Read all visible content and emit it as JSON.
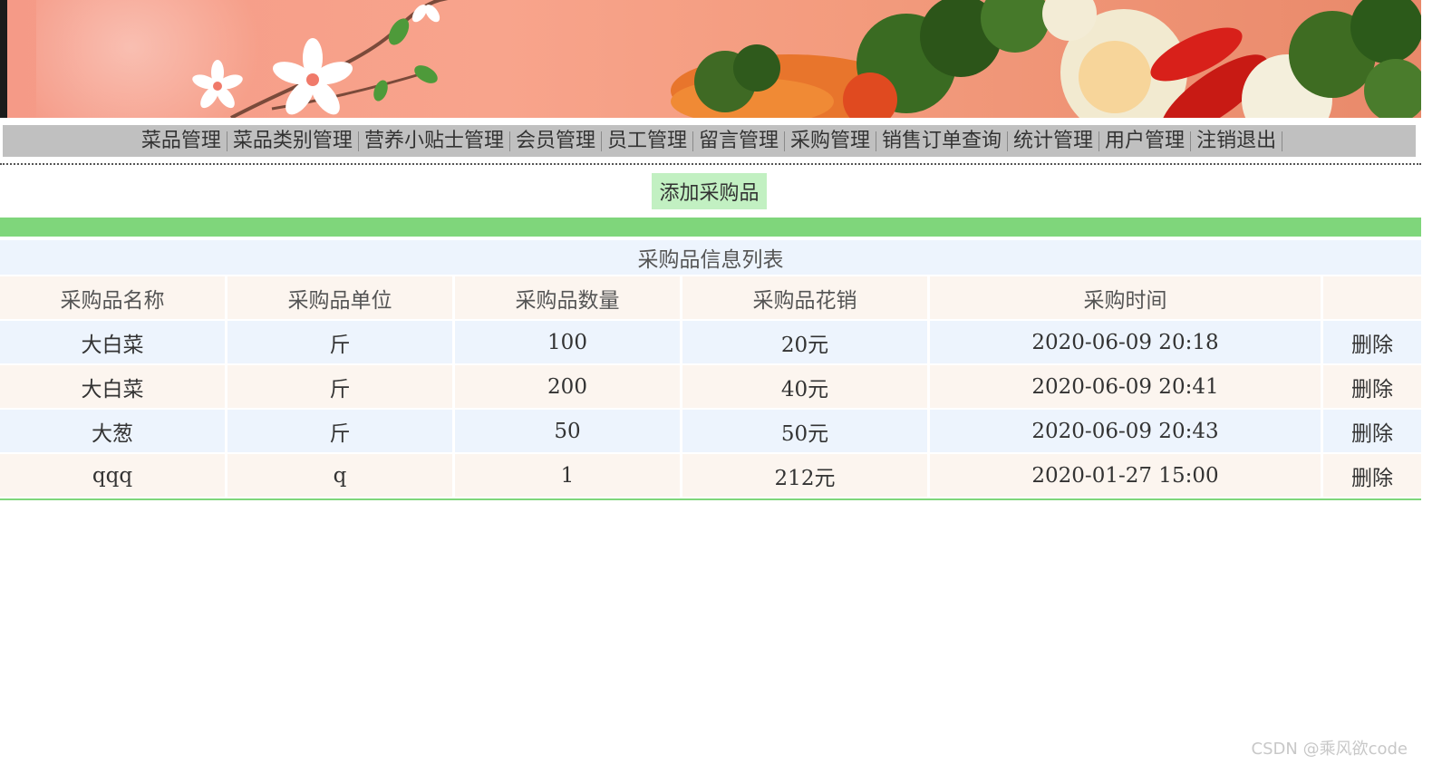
{
  "nav": {
    "items": [
      {
        "label": "菜品管理"
      },
      {
        "label": "菜品类别管理"
      },
      {
        "label": "营养小贴士管理"
      },
      {
        "label": "会员管理"
      },
      {
        "label": "员工管理"
      },
      {
        "label": "留言管理"
      },
      {
        "label": "采购管理"
      },
      {
        "label": "销售订单查询"
      },
      {
        "label": "统计管理"
      },
      {
        "label": "用户管理"
      },
      {
        "label": "注销退出"
      }
    ]
  },
  "actions": {
    "add_label": "添加采购品"
  },
  "table": {
    "caption": "采购品信息列表",
    "headers": [
      "采购品名称",
      "采购品单位",
      "采购品数量",
      "采购品花销",
      "采购时间",
      ""
    ],
    "rows": [
      {
        "name": "大白菜",
        "unit": "斤",
        "quantity": "100",
        "cost": "20元",
        "time": "2020-06-09 20:18",
        "action": "删除"
      },
      {
        "name": "大白菜",
        "unit": "斤",
        "quantity": "200",
        "cost": "40元",
        "time": "2020-06-09 20:41",
        "action": "删除"
      },
      {
        "name": "大葱",
        "unit": "斤",
        "quantity": "50",
        "cost": "50元",
        "time": "2020-06-09 20:43",
        "action": "删除"
      },
      {
        "name": "qqq",
        "unit": "q",
        "quantity": "1",
        "cost": "212元",
        "time": "2020-01-27 15:00",
        "action": "删除"
      }
    ]
  },
  "watermark": "CSDN @乘风欲code",
  "colors": {
    "nav_bg": "#c0c0c0",
    "add_button_bg": "#c2f0c2",
    "green_band": "#7fd67b",
    "row_blue": "#edf4fd",
    "row_cream": "#fcf5ef"
  },
  "banner": {
    "decorations": [
      "white-flower-icon",
      "vegetables-image"
    ]
  }
}
